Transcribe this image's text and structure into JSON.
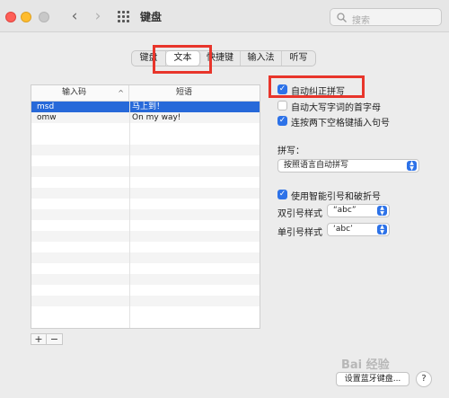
{
  "window": {
    "title": "键盘"
  },
  "search": {
    "placeholder": "搜索"
  },
  "tabs": [
    {
      "label": "键盘"
    },
    {
      "label": "文本"
    },
    {
      "label": "快捷键"
    },
    {
      "label": "输入法"
    },
    {
      "label": "听写"
    }
  ],
  "table": {
    "headers": [
      "输入码",
      "短语"
    ],
    "rows": [
      [
        "msd",
        "马上到！"
      ],
      [
        "omw",
        "On my way!"
      ]
    ]
  },
  "table_controls": {
    "add": "+",
    "remove": "−"
  },
  "options": {
    "auto_correct": "自动纠正拼写",
    "auto_capitalize": "自动大写字词的首字母",
    "double_space_period": "连按两下空格键插入句号"
  },
  "spelling": {
    "label": "拼写：",
    "value": "按照语言自动拼写"
  },
  "smart_quotes": {
    "label": "使用智能引号和破折号",
    "double_label": "双引号样式",
    "double_value": "“abc”",
    "single_label": "单引号样式",
    "single_value": "‘abc’"
  },
  "footer": {
    "setup_button": "设置蓝牙键盘...",
    "help": "?"
  },
  "watermark": "Bai 经验",
  "colors": {
    "accent": "#2d72e8",
    "selection": "#2769d9",
    "highlight_box": "#e8352b"
  }
}
